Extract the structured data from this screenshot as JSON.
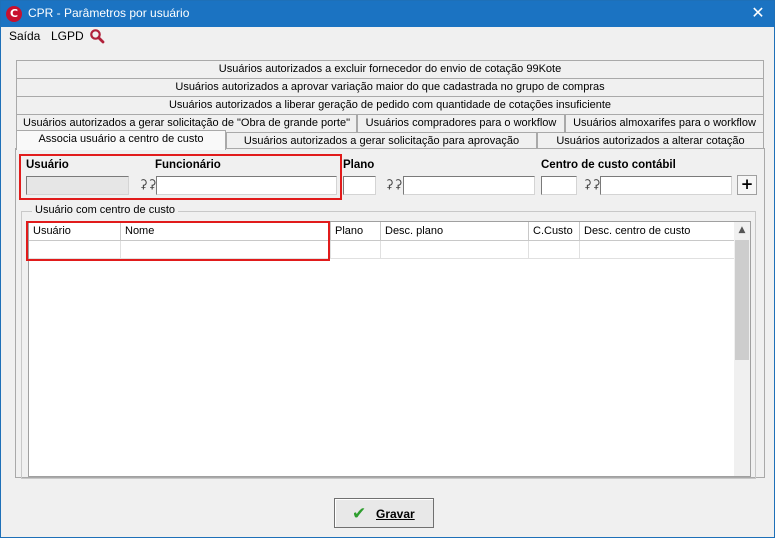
{
  "window": {
    "title": "CPR - Parâmetros por usuário",
    "close": "✕",
    "app_icon": "C"
  },
  "menu": {
    "items": [
      "Saída",
      "LGPD"
    ],
    "search_icon": "search-icon"
  },
  "tabs": {
    "row1": "Usuários autorizados a excluir fornecedor do envio de cotação 99Kote",
    "row2": "Usuários autorizados a aprovar variação maior do que cadastrada no grupo de compras",
    "row3": "Usuários autorizados a liberar geração de pedido com quantidade de cotações insuficiente",
    "row4": [
      "Usuários autorizados a gerar solicitação de \"Obra de grande porte\"",
      "Usuários compradores para o workflow",
      "Usuários almoxarifes para o workflow"
    ],
    "row5": [
      "Associa usuário a centro de custo",
      "Usuários autorizados a gerar solicitação para aprovação",
      "Usuários autorizados a alterar cotação"
    ]
  },
  "form": {
    "usuario_label": "Usuário",
    "funcionario_label": "Funcionário",
    "plano_label": "Plano",
    "centro_label": "Centro de custo contábil",
    "add_label": "+"
  },
  "group": {
    "title": "Usuário com centro de custo",
    "columns": [
      "Usuário",
      "Nome",
      "Plano",
      "Desc. plano",
      "C.Custo",
      "Desc. centro de custo"
    ]
  },
  "footer": {
    "save_label": "Gravar"
  },
  "colors": {
    "titlebar": "#1b73c2",
    "highlight": "#e11b1b",
    "check": "#2e9e2e"
  }
}
